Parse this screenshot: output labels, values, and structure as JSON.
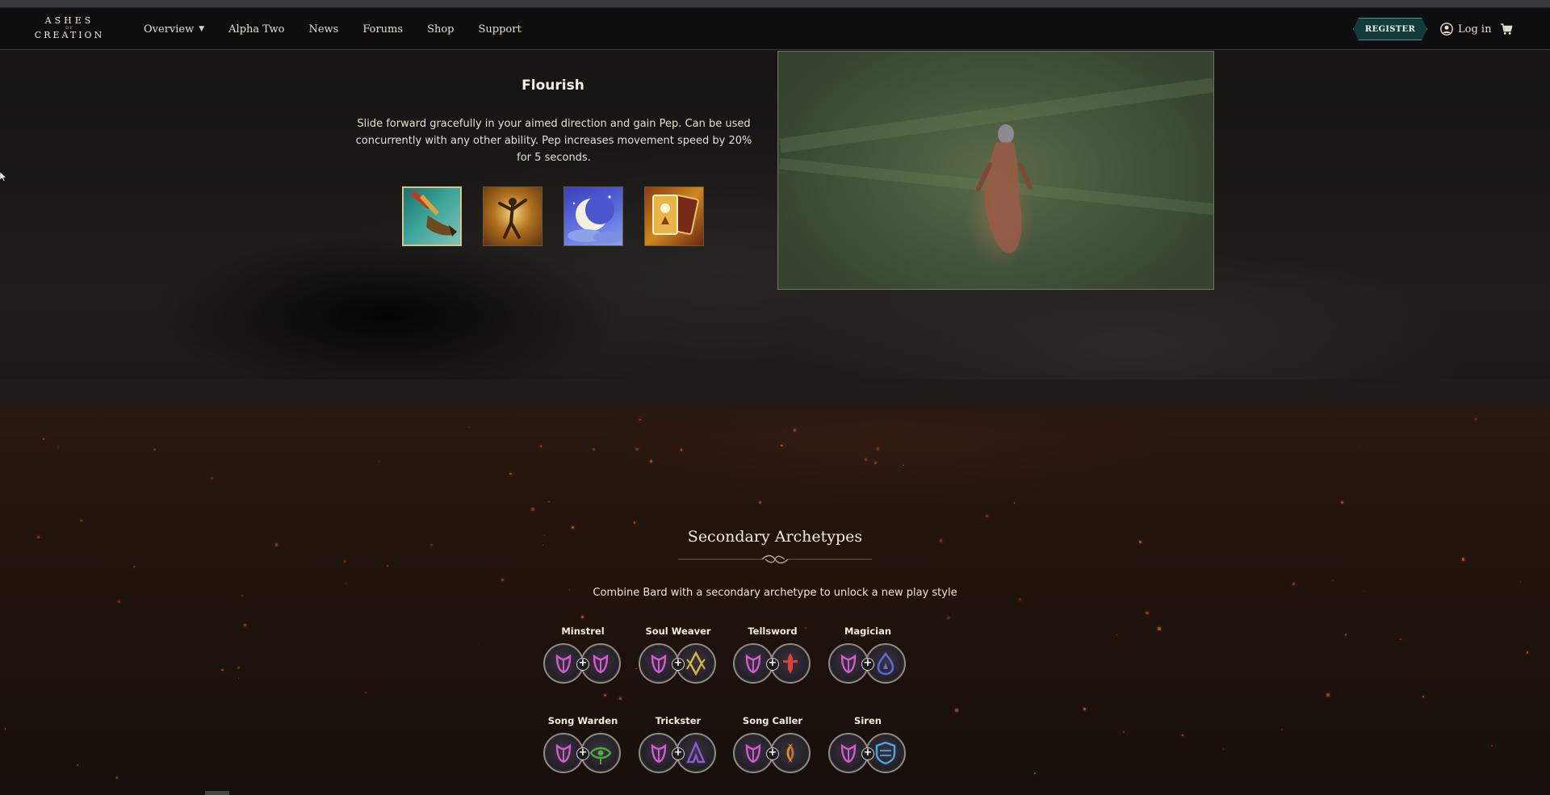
{
  "nav": {
    "logo": {
      "line1": "ASHES",
      "line2": "OF",
      "line3": "CREATION"
    },
    "links": [
      {
        "label": "Overview",
        "has_dropdown": true
      },
      {
        "label": "Alpha Two"
      },
      {
        "label": "News"
      },
      {
        "label": "Forums"
      },
      {
        "label": "Shop"
      },
      {
        "label": "Support"
      }
    ],
    "register_label": "REGISTER",
    "login_label": "Log in",
    "accent_color": "#123c3a"
  },
  "ability": {
    "title": "Flourish",
    "description": "Slide forward gracefully in your aimed direction and gain Pep. Can be used concurrently with any other ability. Pep increases movement speed by 20% for 5 seconds.",
    "icons": [
      {
        "name": "flourish-ability-icon",
        "selected": true
      },
      {
        "name": "pep-ability-icon",
        "selected": false
      },
      {
        "name": "moon-ability-icon",
        "selected": false
      },
      {
        "name": "cards-ability-icon",
        "selected": false
      }
    ]
  },
  "secondary": {
    "title": "Secondary Archetypes",
    "subtitle": "Combine Bard with a secondary archetype to unlock a new play style",
    "archetypes": [
      {
        "label": "Minstrel",
        "secondary_icon": "bard-icon",
        "color": "#d45ad0"
      },
      {
        "label": "Soul Weaver",
        "secondary_icon": "cleric-icon",
        "color": "#d9b83a"
      },
      {
        "label": "Tellsword",
        "secondary_icon": "fighter-icon",
        "color": "#d8443a"
      },
      {
        "label": "Magician",
        "secondary_icon": "mage-icon",
        "color": "#5a6ee0"
      },
      {
        "label": "Song Warden",
        "secondary_icon": "ranger-icon",
        "color": "#4caa3a"
      },
      {
        "label": "Trickster",
        "secondary_icon": "rogue-icon",
        "color": "#8a5ad8"
      },
      {
        "label": "Song Caller",
        "secondary_icon": "summoner-icon",
        "color": "#e08a2a"
      },
      {
        "label": "Siren",
        "secondary_icon": "tank-icon",
        "color": "#4aa8e0"
      }
    ]
  }
}
